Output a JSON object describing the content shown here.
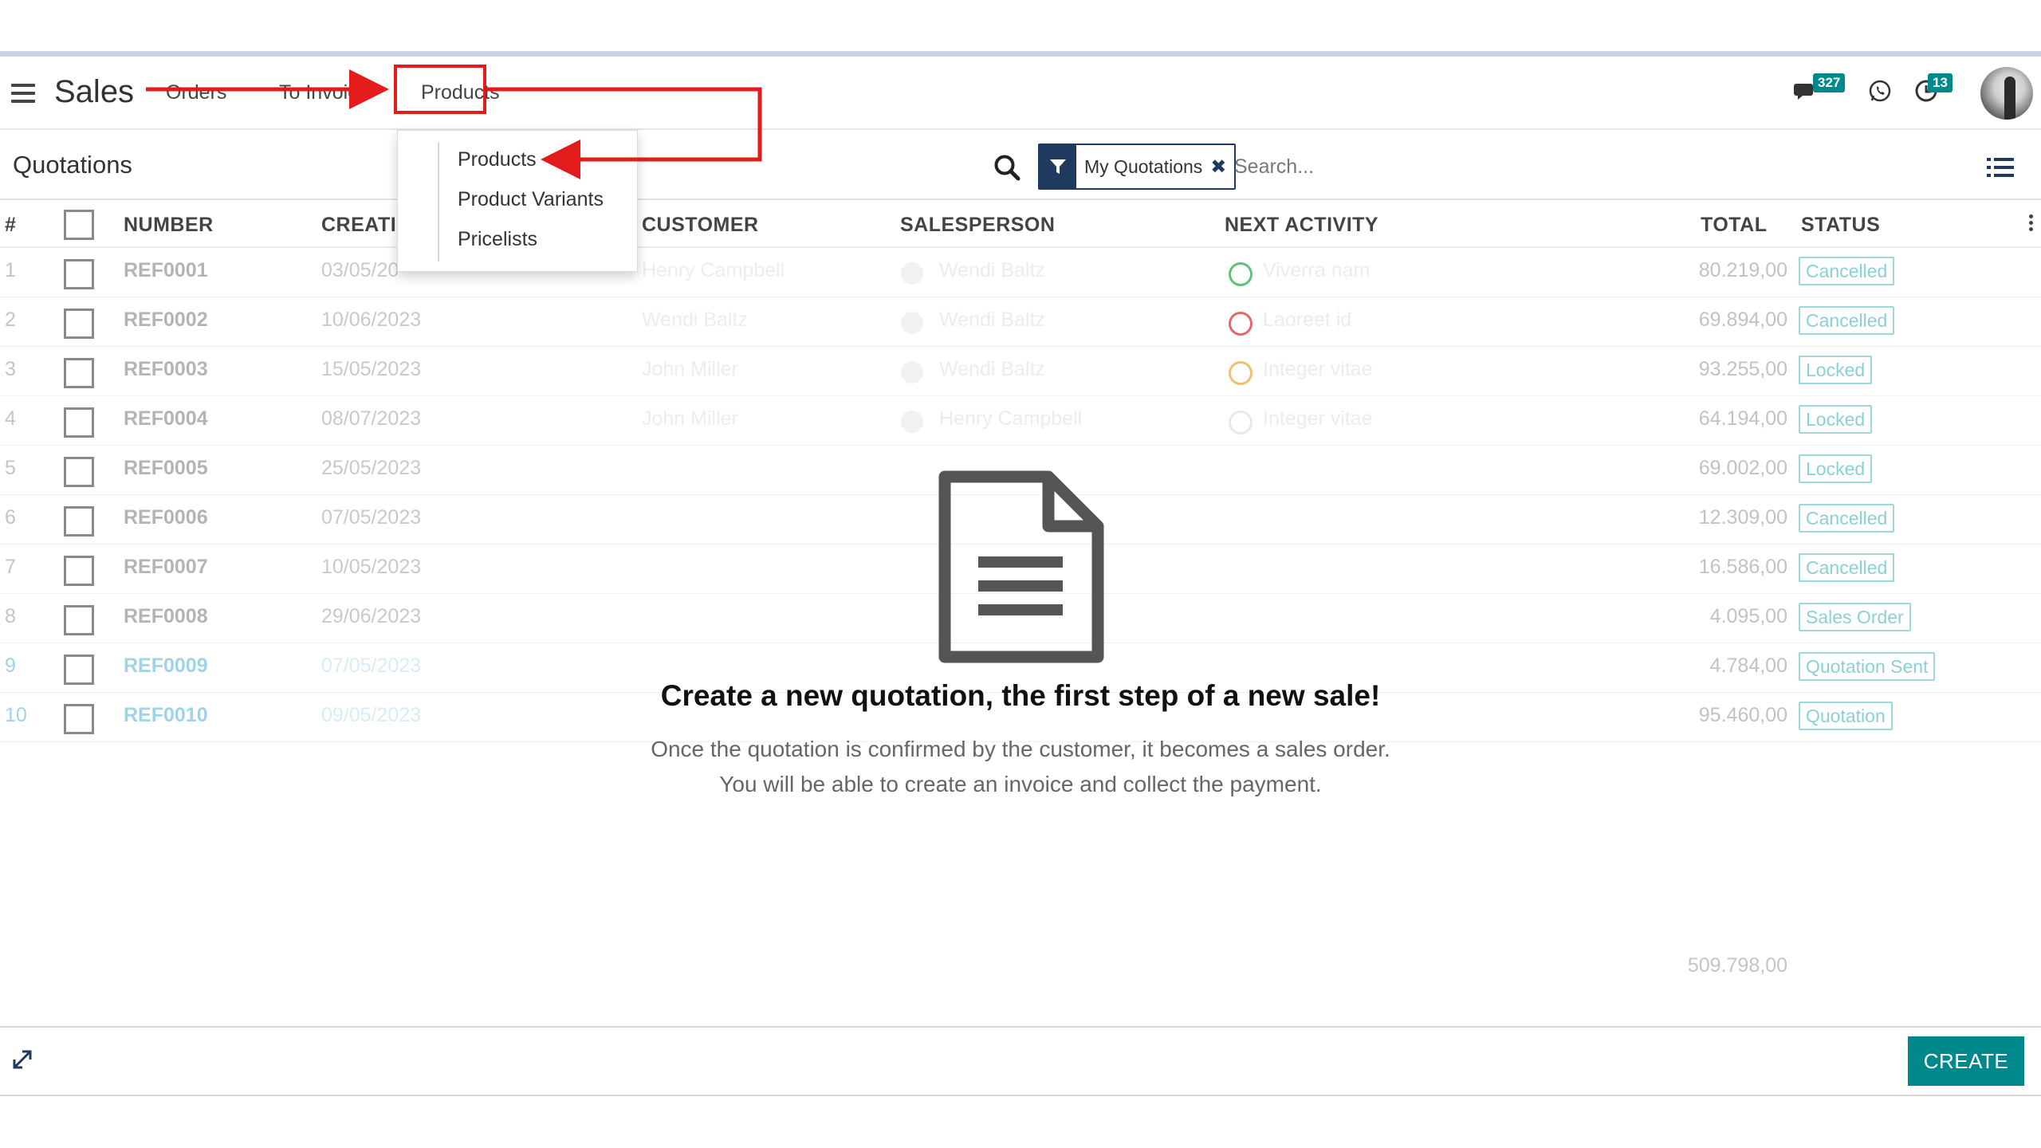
{
  "app": {
    "title": "Sales"
  },
  "nav": {
    "items": [
      {
        "label": "Orders"
      },
      {
        "label": "To Invoice"
      },
      {
        "label": "Products"
      }
    ],
    "badges": {
      "messages": "327",
      "activities": "13"
    }
  },
  "dropdown": {
    "items": [
      {
        "label": "Products"
      },
      {
        "label": "Product Variants"
      },
      {
        "label": "Pricelists"
      }
    ]
  },
  "control": {
    "breadcrumb": "Quotations",
    "facet_label": "My Quotations",
    "search_placeholder": "Search..."
  },
  "table": {
    "headers": {
      "index": "#",
      "number": "NUMBER",
      "creation": "CREATI",
      "customer": "CUSTOMER",
      "salesperson": "SALESPERSON",
      "next_activity": "NEXT ACTIVITY",
      "total": "TOTAL",
      "status": "STATUS"
    },
    "rows": [
      {
        "idx": "1",
        "number": "REF0001",
        "date": "03/05/20",
        "customer": "Henry Campbell",
        "salesperson": "Wendi Baltz",
        "activity": "Viverra nam",
        "activity_color": "#5cc27a",
        "total": "80.219,00",
        "status": "Cancelled"
      },
      {
        "idx": "2",
        "number": "REF0002",
        "date": "10/06/2023",
        "customer": "Wendi Baltz",
        "salesperson": "Wendi Baltz",
        "activity": "Laoreet id",
        "activity_color": "#e06a6a",
        "total": "69.894,00",
        "status": "Cancelled"
      },
      {
        "idx": "3",
        "number": "REF0003",
        "date": "15/05/2023",
        "customer": "John Miller",
        "salesperson": "Wendi Baltz",
        "activity": "Integer vitae",
        "activity_color": "#f0c070",
        "total": "93.255,00",
        "status": "Locked"
      },
      {
        "idx": "4",
        "number": "REF0004",
        "date": "08/07/2023",
        "customer": "John Miller",
        "salesperson": "Henry Campbell",
        "activity": "Integer vitae",
        "activity_color": "#e8e8e8",
        "total": "64.194,00",
        "status": "Locked"
      },
      {
        "idx": "5",
        "number": "REF0005",
        "date": "25/05/2023",
        "customer": "",
        "salesperson": "",
        "activity": "",
        "activity_color": "",
        "total": "69.002,00",
        "status": "Locked"
      },
      {
        "idx": "6",
        "number": "REF0006",
        "date": "07/05/2023",
        "customer": "",
        "salesperson": "",
        "activity": "",
        "activity_color": "",
        "total": "12.309,00",
        "status": "Cancelled"
      },
      {
        "idx": "7",
        "number": "REF0007",
        "date": "10/05/2023",
        "customer": "",
        "salesperson": "",
        "activity": "",
        "activity_color": "",
        "total": "16.586,00",
        "status": "Cancelled"
      },
      {
        "idx": "8",
        "number": "REF0008",
        "date": "29/06/2023",
        "customer": "",
        "salesperson": "",
        "activity": "",
        "activity_color": "",
        "total": "4.095,00",
        "status": "Sales Order"
      },
      {
        "idx": "9",
        "number": "REF0009",
        "date": "07/05/2023",
        "customer": "",
        "salesperson": "",
        "activity": "",
        "activity_color": "",
        "total": "4.784,00",
        "status": "Quotation Sent"
      },
      {
        "idx": "10",
        "number": "REF0010",
        "date": "09/05/2023",
        "customer": "",
        "salesperson": "",
        "activity": "",
        "activity_color": "",
        "total": "95.460,00",
        "status": "Quotation"
      }
    ],
    "sum_total": "509.798,00"
  },
  "helper": {
    "title": "Create a new quotation, the first step of a new sale!",
    "line1": "Once the quotation is confirmed by the customer, it becomes a sales order.",
    "line2": "You will be able to create an invoice and collect the payment."
  },
  "footer": {
    "create_label": "CREATE"
  },
  "colors": {
    "accent": "#00898d",
    "facet_navy": "#1f3a5f",
    "annotation_red": "#e41b1b"
  }
}
